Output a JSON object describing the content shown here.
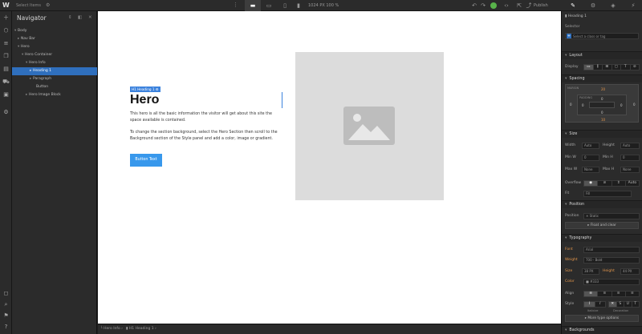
{
  "topbar": {
    "logo": "W",
    "project_name": "Select Items",
    "size_readout": "1024 PX 100 %",
    "publish_label": "Publish"
  },
  "navigator": {
    "title": "Navigator",
    "items": [
      {
        "label": "Body",
        "caret": "▾"
      },
      {
        "label": "Nav Bar",
        "caret": "▸"
      },
      {
        "label": "Hero",
        "caret": "▾"
      },
      {
        "label": "Hero Container",
        "caret": "▾"
      },
      {
        "label": "Hero Info",
        "caret": "▾"
      },
      {
        "label": "Heading 1",
        "caret": "▸"
      },
      {
        "label": "Paragraph",
        "caret": "▸"
      },
      {
        "label": "Button",
        "caret": ""
      },
      {
        "label": "Hero Image Block",
        "caret": "▸"
      }
    ]
  },
  "canvas": {
    "selected_badge": "H1 Heading 1 ⚙",
    "hero_title": "Hero",
    "paragraph_1": "This hero is all the basic information the visitor will get about this site the space available is contained.",
    "paragraph_2": "To change the section background, select the Hero Section then scroll to the Background section of the Style panel and add a color, image or gradient.",
    "button_label": "Button Text"
  },
  "breadcrumbs": [
    "Hero Info",
    "H1 Heading 1"
  ],
  "panel": {
    "element_name": "Heading 1",
    "selector_label": "Selector",
    "selector_placeholder": "Select a class or tag",
    "layout_title": "Layout",
    "display_label": "Display",
    "spacing_title": "Spacing",
    "margin_label": "MARGIN",
    "padding_label": "PADDING",
    "margin_top": "20",
    "margin_bottom": "10",
    "margin_left": "0",
    "margin_right": "0",
    "padding_top": "0",
    "padding_bottom": "0",
    "padding_left": "0",
    "padding_right": "0",
    "size_title": "Size",
    "width_label": "Width",
    "width_value": "Auto",
    "height_label": "Height",
    "height_value": "Auto",
    "minw_label": "Min W",
    "minw_value": "0",
    "minh_label": "Min H",
    "minh_value": "0",
    "maxw_label": "Max W",
    "maxw_value": "None",
    "maxh_label": "Max H",
    "maxh_value": "None",
    "overflow_label": "Overflow",
    "overflow_auto": "Auto",
    "fit_label": "Fit",
    "fit_value": "Fill",
    "position_title": "Position",
    "position_label": "Position",
    "position_value": "Static",
    "float_clear": "Float and clear",
    "typography_title": "Typography",
    "font_label": "Font",
    "font_value": "Arial",
    "weight_label": "Weight",
    "weight_value": "700 - Bold",
    "size_label": "Size",
    "size_value": "38",
    "size_unit": "PX",
    "lineheight_label": "Height",
    "lineheight_value": "44",
    "lineheight_unit": "PX",
    "color_label": "Color",
    "color_value": "#333",
    "align_label": "Align",
    "style_label": "Style",
    "italicize": "Italicize",
    "decoration": "Decoration",
    "more_type": "More type options",
    "backgrounds_title": "Backgrounds"
  },
  "colors": {
    "accent": "#3b82dd",
    "button": "#3898ec",
    "success": "#58b24a",
    "label_orange": "#e2954b"
  }
}
